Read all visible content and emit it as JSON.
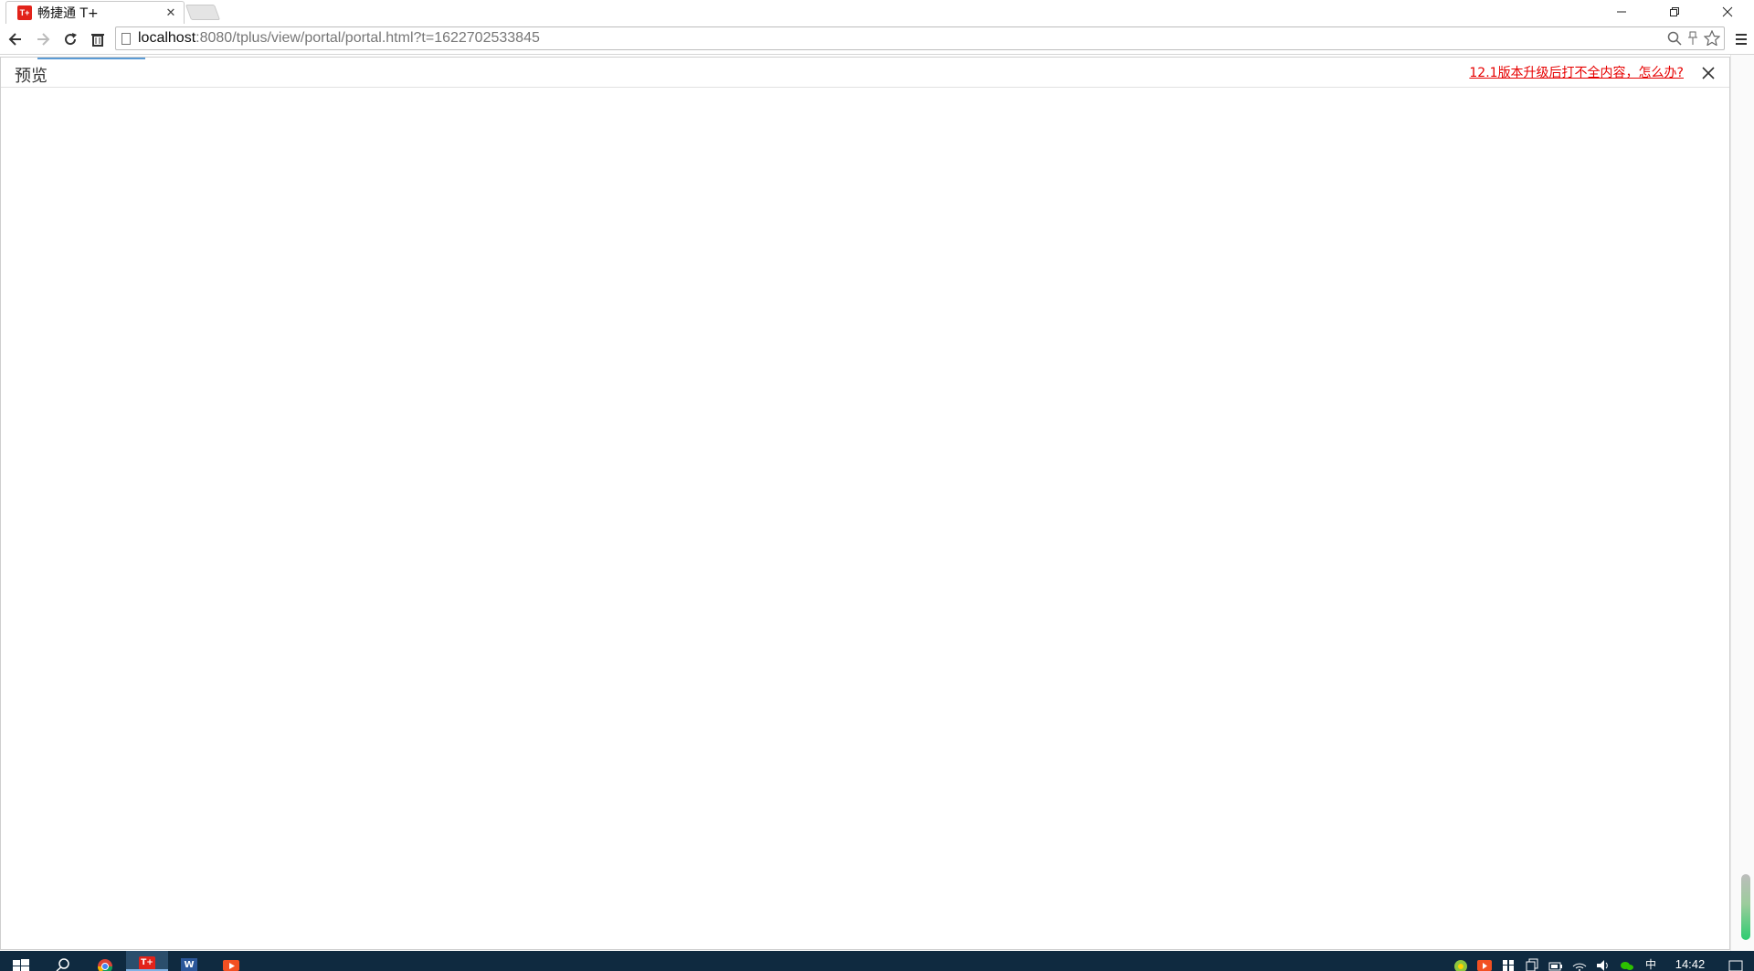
{
  "browser": {
    "tab_title": "畅捷通 T+",
    "tab_favicon_text": "T+",
    "url_host": "localhost",
    "url_rest": ":8080/tplus/view/portal/portal.html?t=1622702533845"
  },
  "preview": {
    "title": "预览",
    "help_link": "12.1版本升级后打不全内容，怎么办?"
  },
  "taskbar": {
    "tplus_label": "T+",
    "word_label": "W",
    "clock": "14:42",
    "ime": "中"
  },
  "colors": {
    "link_red": "#e60000",
    "taskbar_bg": "#0f2a40",
    "favicon_red": "#e2231a"
  }
}
